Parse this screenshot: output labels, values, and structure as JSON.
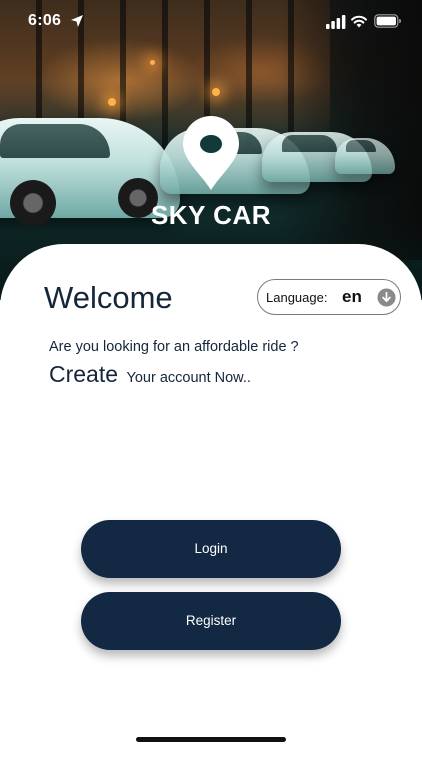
{
  "status_bar": {
    "time": "6:06",
    "icons": [
      "location-arrow-icon",
      "cellular-signal-icon",
      "wifi-icon",
      "battery-icon"
    ]
  },
  "hero": {
    "brand_name": "SKY CAR",
    "logo_icon": "map-pin-icon"
  },
  "welcome": {
    "title": "Welcome",
    "language_label": "Language:",
    "language_value": "en",
    "language_icon": "arrow-down-circle-icon",
    "tagline": "Are you looking for an affordable ride ?",
    "create_word": "Create",
    "create_rest": "Your account Now.."
  },
  "actions": {
    "login_label": "Login",
    "register_label": "Register"
  },
  "colors": {
    "primary": "#132943",
    "text_dark": "#15263b",
    "background": "#ffffff"
  }
}
